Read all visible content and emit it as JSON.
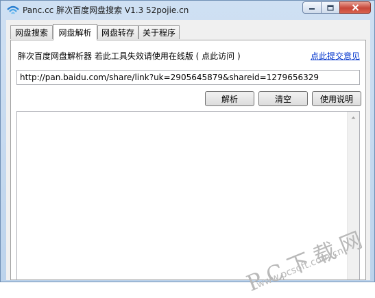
{
  "window": {
    "title": "Panc.cc 胖次百度网盘搜索 V1.3  52pojie.cn"
  },
  "tabs": [
    "网盘搜索",
    "网盘解析",
    "网盘转存",
    "关于程序"
  ],
  "info": {
    "label": "胖次百度网盘解析器   若此工具失效请使用在线版 ( 点此访问 )",
    "feedback_link": "点此提交意见"
  },
  "url_input": {
    "value": "http://pan.baidu.com/share/link?uk=2905645879&shareid=1279656329"
  },
  "buttons": {
    "parse": "解析",
    "clear": "清空",
    "help": "使用说明"
  },
  "watermark": {
    "brand": "PC下载网",
    "url": "www.pcsoft.com.cn"
  },
  "icons": {
    "app": "panc-logo-icon",
    "minimize": "minimize-icon",
    "maximize": "maximize-icon",
    "close": "close-icon",
    "scroll_up": "scroll-up-arrow-icon"
  },
  "colors": {
    "link": "#0033cc",
    "title_bar": "#c4d8ee",
    "close_button": "#c7473a"
  }
}
